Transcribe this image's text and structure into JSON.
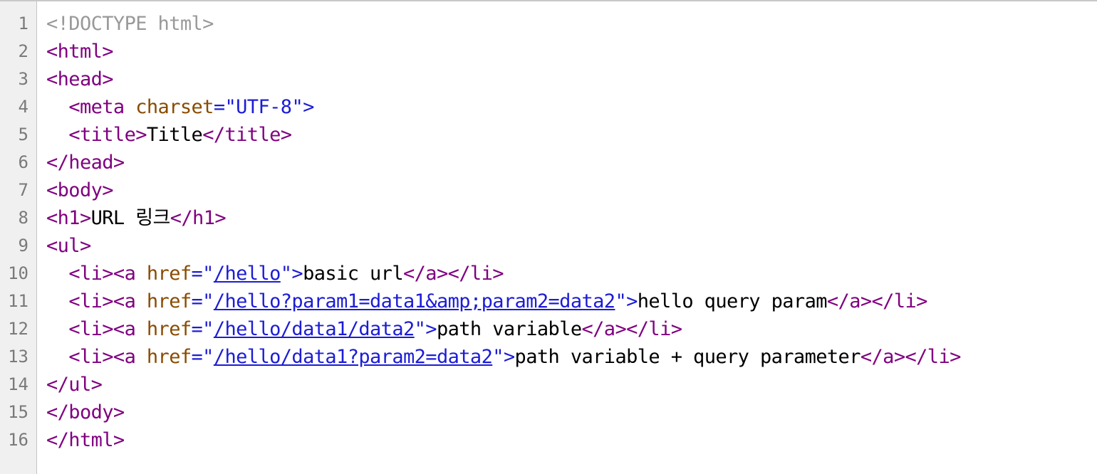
{
  "editor": {
    "line_numbers": [
      "1",
      "2",
      "3",
      "4",
      "5",
      "6",
      "7",
      "8",
      "9",
      "10",
      "11",
      "12",
      "13",
      "14",
      "15",
      "16"
    ],
    "lines": {
      "l1": {
        "doctype": "<!DOCTYPE html>"
      },
      "l2": {
        "tag": "<html>"
      },
      "l3": {
        "tag": "<head>"
      },
      "l4": {
        "indent": "  ",
        "open": "<meta",
        "attr": " charset",
        "eq": "=\"",
        "value": "UTF-8",
        "close": "\">"
      },
      "l5": {
        "indent": "  ",
        "open": "<title>",
        "text": "Title",
        "close": "</title>"
      },
      "l6": {
        "tag": "</head>"
      },
      "l7": {
        "tag": "<body>"
      },
      "l8": {
        "open": "<h1>",
        "text": "URL 링크",
        "close": "</h1>"
      },
      "l9": {
        "tag": "<ul>"
      },
      "l10": {
        "indent": "  ",
        "open": "<li><a",
        "attr": " href",
        "eq": "=\"",
        "url": "/hello",
        "q": "\">",
        "text": "basic url",
        "close": "</a></li>"
      },
      "l11": {
        "indent": "  ",
        "open": "<li><a",
        "attr": " href",
        "eq": "=\"",
        "url": "/hello?param1=data1&amp;param2=data2",
        "q": "\">",
        "text": "hello query param",
        "close": "</a></li>"
      },
      "l12": {
        "indent": "  ",
        "open": "<li><a",
        "attr": " href",
        "eq": "=\"",
        "url": "/hello/data1/data2",
        "q": "\">",
        "text": "path variable",
        "close": "</a></li>"
      },
      "l13": {
        "indent": "  ",
        "open": "<li><a",
        "attr": " href",
        "eq": "=\"",
        "url": "/hello/data1?param2=data2",
        "q": "\">",
        "text": "path variable + query parameter",
        "close": "</a></li>"
      },
      "l14": {
        "tag": "</ul>"
      },
      "l15": {
        "tag": "</body>"
      },
      "l16": {
        "tag": "</html>"
      }
    }
  }
}
